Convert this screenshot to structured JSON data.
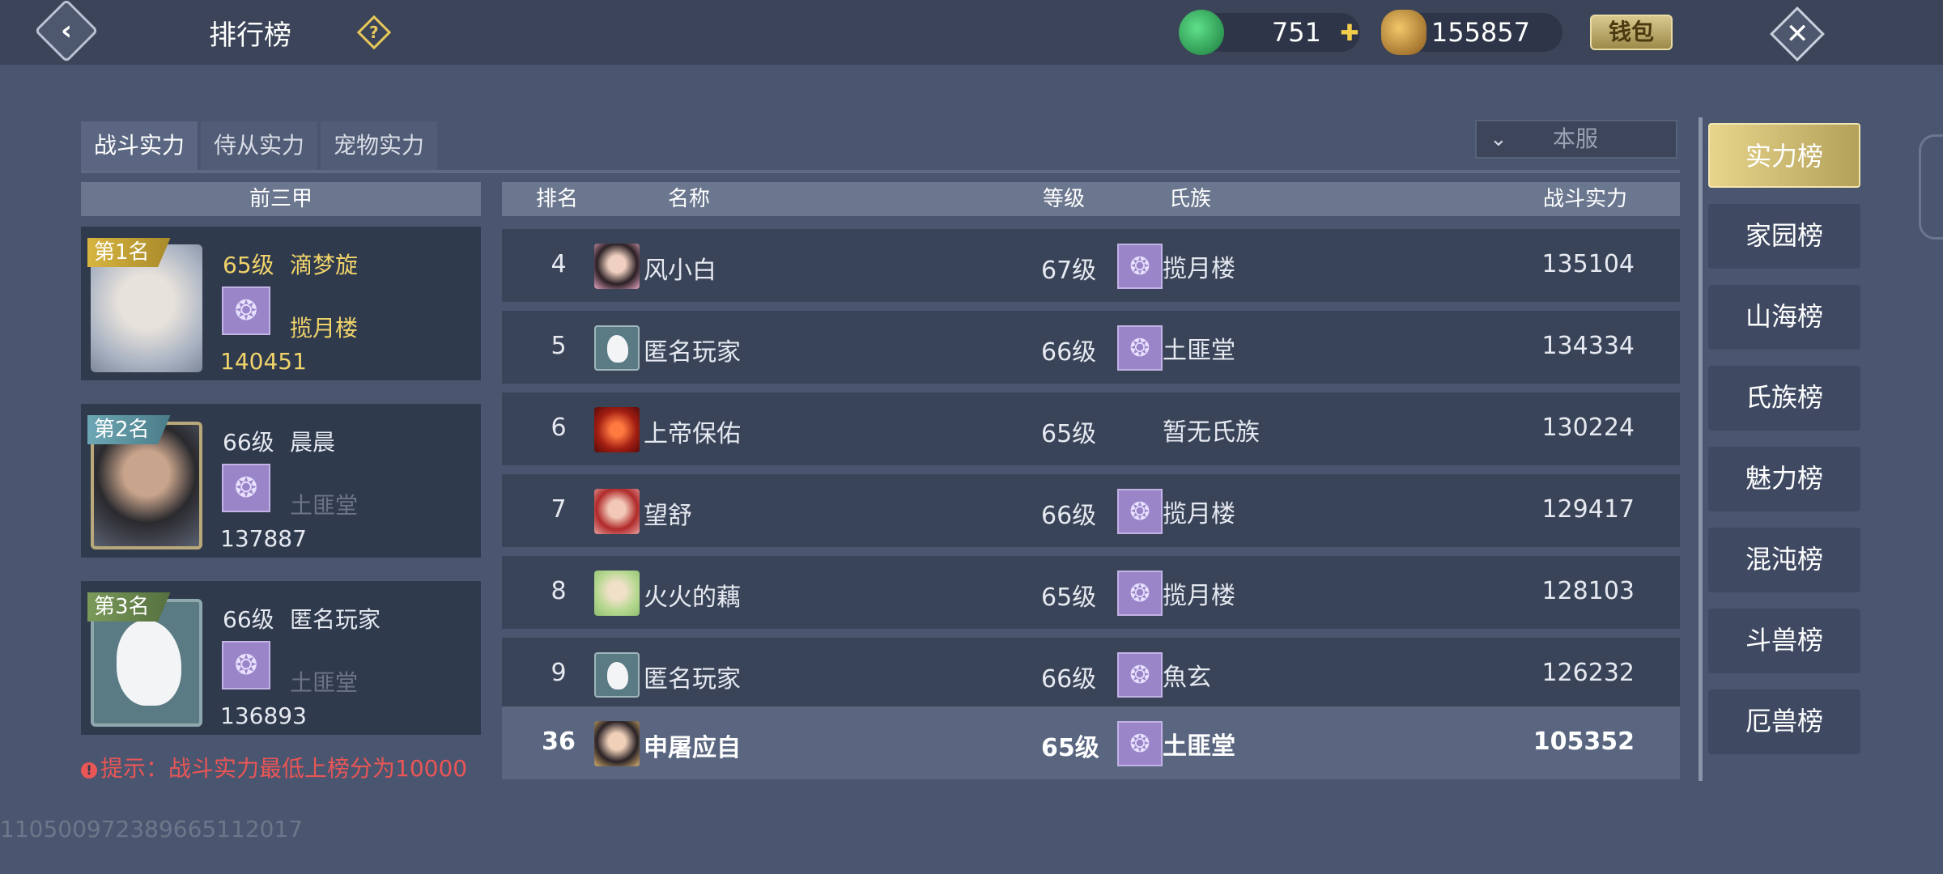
{
  "header": {
    "title": "排行榜",
    "jade": "751",
    "coins": "155857",
    "wallet_label": "钱包"
  },
  "tabs": [
    {
      "label": "战斗实力",
      "active": true
    },
    {
      "label": "侍从实力",
      "active": false
    },
    {
      "label": "宠物实力",
      "active": false
    }
  ],
  "server_filter": "本服",
  "top3": {
    "header": "前三甲",
    "players": [
      {
        "badge": "第1名",
        "level": "65级",
        "name": "滴梦旋",
        "clan": "揽月楼",
        "power": "140451"
      },
      {
        "badge": "第2名",
        "level": "66级",
        "name": "晨晨",
        "clan": "土匪堂",
        "power": "137887"
      },
      {
        "badge": "第3名",
        "level": "66级",
        "name": "匿名玩家",
        "clan": "土匪堂",
        "power": "136893"
      }
    ]
  },
  "tip": "提示：战斗实力最低上榜分为10000",
  "list": {
    "columns": {
      "rank": "排名",
      "name": "名称",
      "level": "等级",
      "clan": "氏族",
      "power": "战斗实力"
    },
    "rows": [
      {
        "rank": "4",
        "name": "风小白",
        "level": "67级",
        "clan": "揽月楼",
        "power": "135104"
      },
      {
        "rank": "5",
        "name": "匿名玩家",
        "level": "66级",
        "clan": "土匪堂",
        "power": "134334"
      },
      {
        "rank": "6",
        "name": "上帝保佑",
        "level": "65级",
        "clan": "暂无氏族",
        "power": "130224"
      },
      {
        "rank": "7",
        "name": "望舒",
        "level": "66级",
        "clan": "揽月楼",
        "power": "129417"
      },
      {
        "rank": "8",
        "name": "火火的藕",
        "level": "65级",
        "clan": "揽月楼",
        "power": "128103"
      },
      {
        "rank": "9",
        "name": "匿名玩家",
        "level": "66级",
        "clan": "魚玄",
        "power": "126232"
      }
    ],
    "my_row": {
      "rank": "36",
      "name": "申屠应自",
      "level": "65级",
      "clan": "土匪堂",
      "power": "105352"
    }
  },
  "boards": [
    "实力榜",
    "家园榜",
    "山海榜",
    "氏族榜",
    "魅力榜",
    "混沌榜",
    "斗兽榜",
    "厄兽榜"
  ],
  "active_board": "实力榜",
  "uid": "1105009723896651120​17",
  "colors": {
    "accent_gold": "#f0d36a",
    "tip_red": "#e85656",
    "clan_purple": "#9a85c8"
  }
}
